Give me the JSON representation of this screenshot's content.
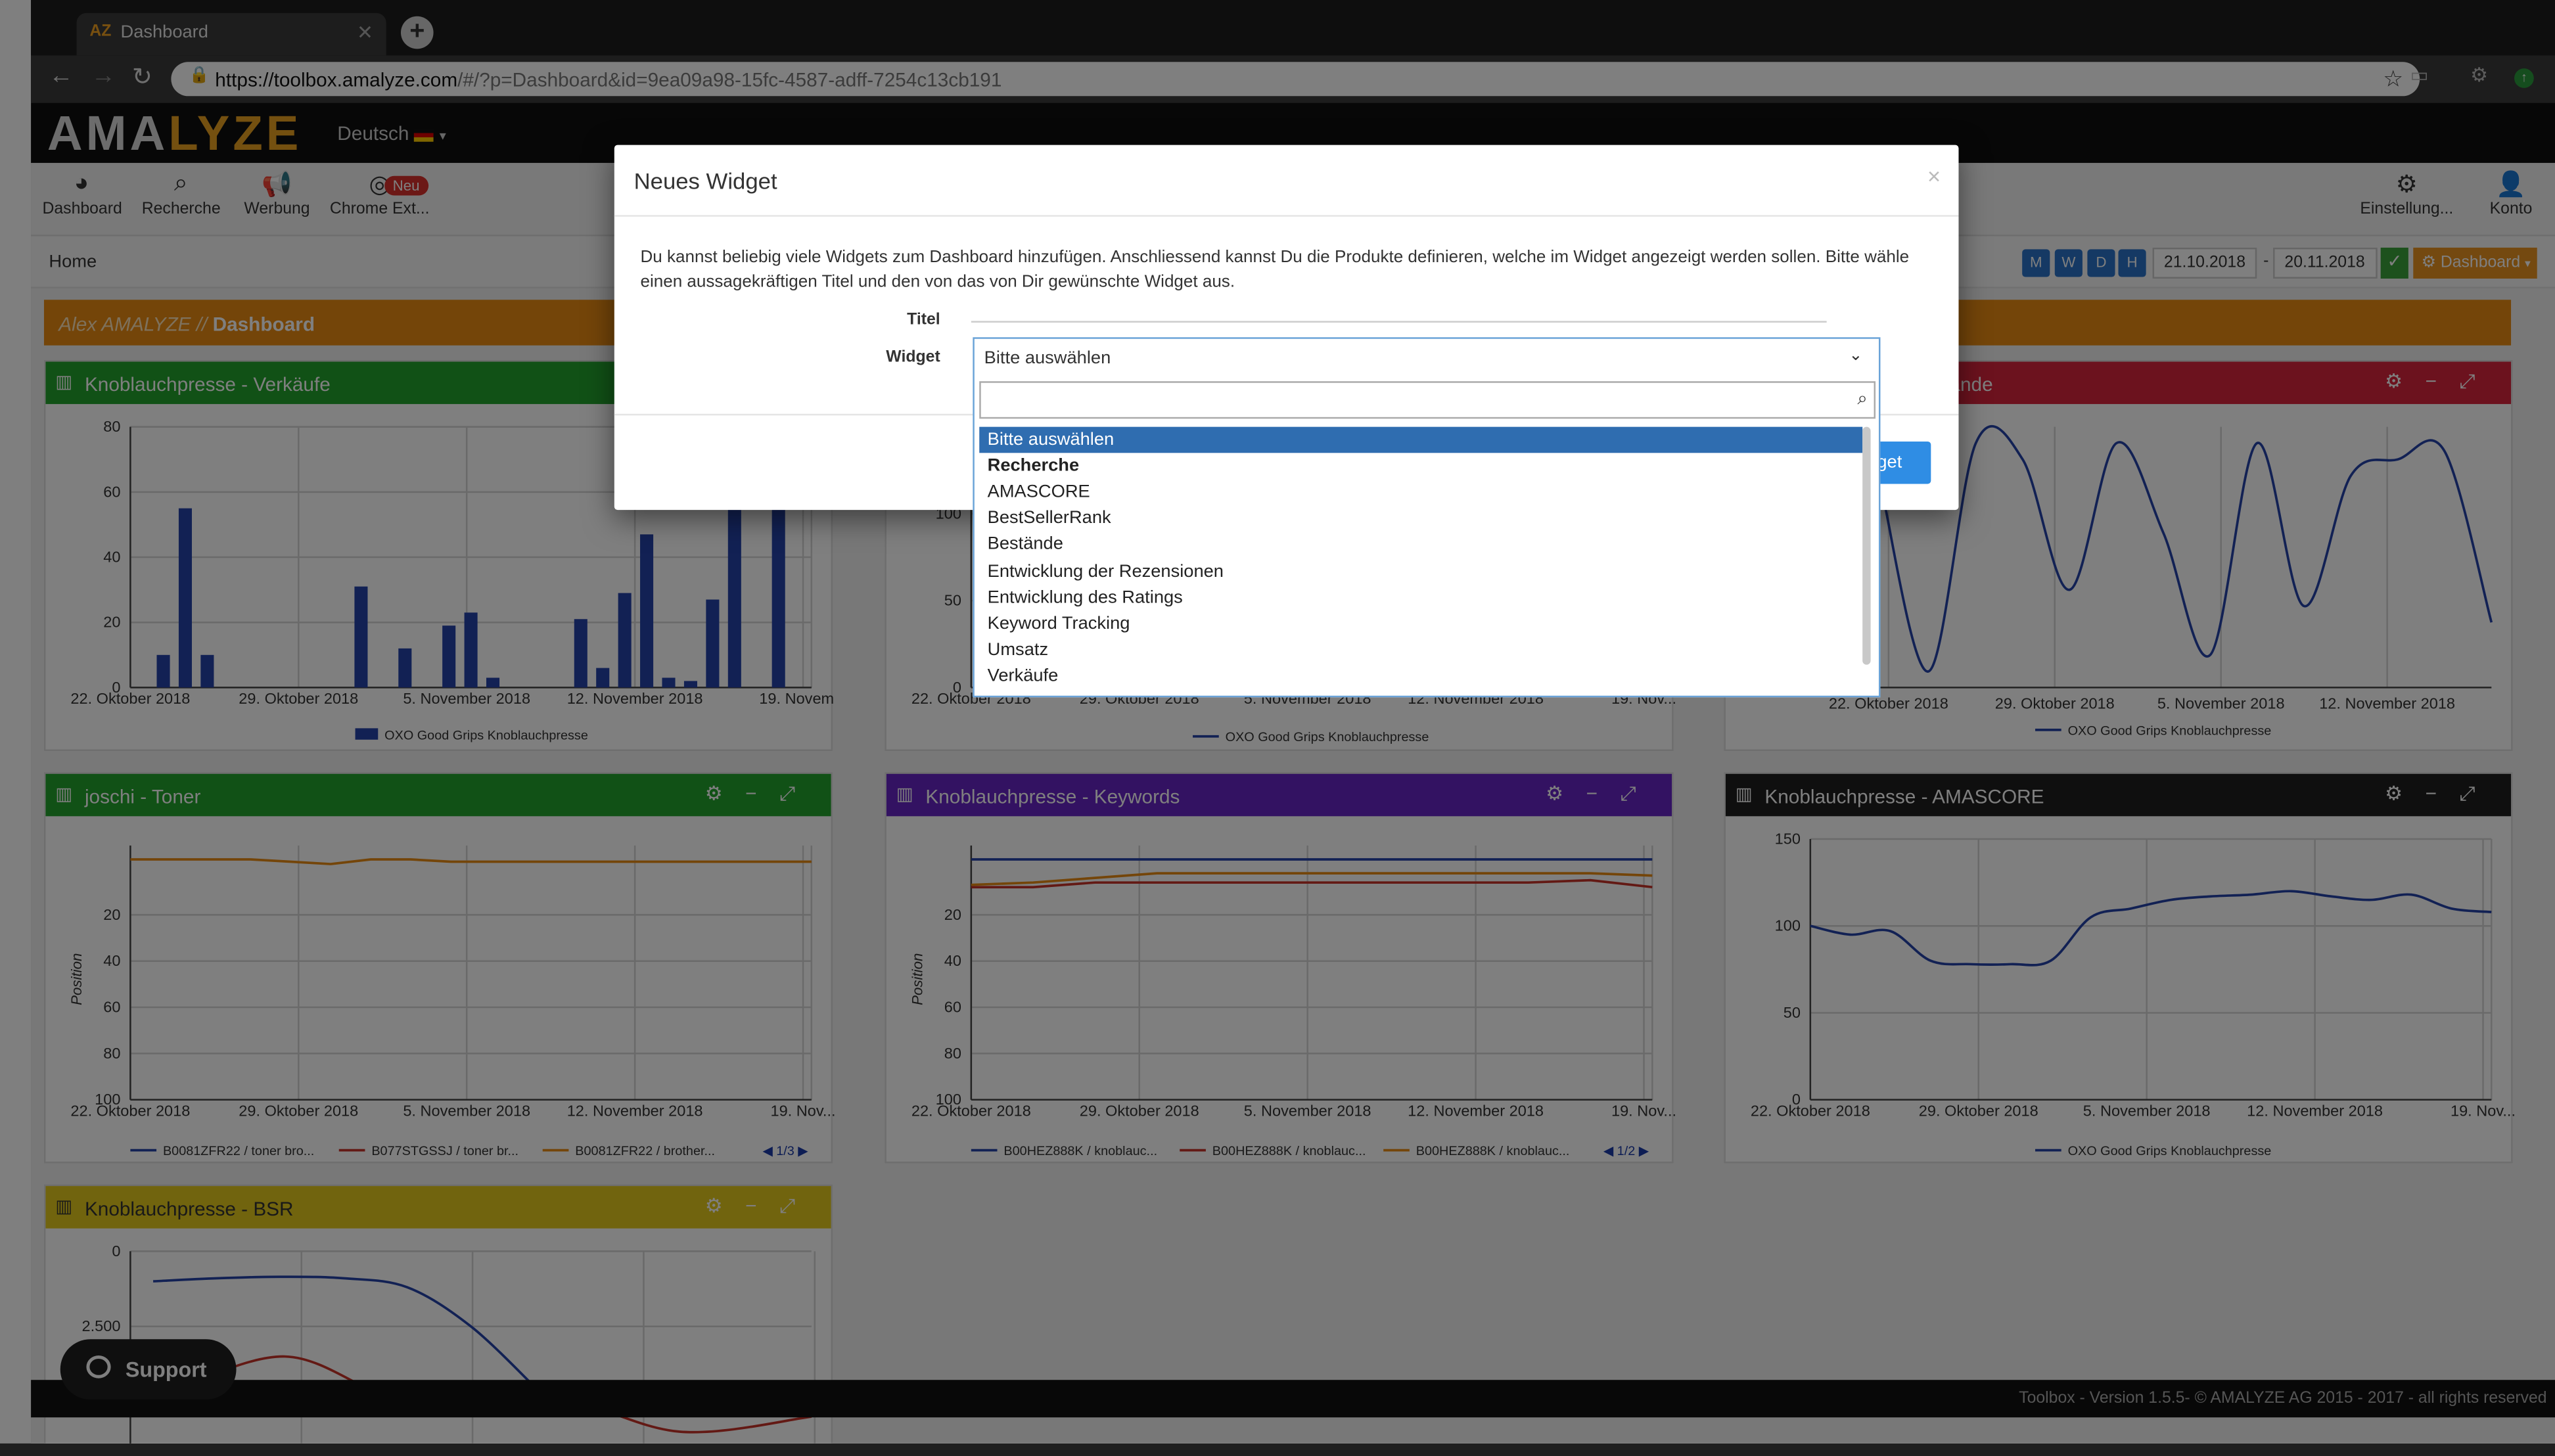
{
  "browser": {
    "tab_title": "Dashboard",
    "favicon_text": "AZ",
    "url_domain": "https://toolbox.amalyze.com",
    "url_path": "/#/?p=Dashboard&id=9ea09a98-15fc-4587-adff-7254c13cb191"
  },
  "app": {
    "logo_main": "AMA",
    "logo_accent": "LYZE",
    "language": "Deutsch",
    "menu": [
      {
        "label": "Dashboard",
        "icon": "dashboard-icon"
      },
      {
        "label": "Recherche",
        "icon": "search-icon"
      },
      {
        "label": "Werbung",
        "icon": "megaphone-icon"
      },
      {
        "label": "Chrome Ext...",
        "icon": "chrome-icon"
      }
    ],
    "badge_new": "Neu",
    "settings_label": "Einstellung...",
    "account_label": "Konto",
    "breadcrumb": "Home",
    "periods": [
      "M",
      "W",
      "D",
      "H"
    ],
    "date_from": "21.10.2018",
    "date_sep": "-",
    "date_to": "20.11.2018",
    "dashboard_button": "Dashboard",
    "page_user": "Alex AMALYZE //",
    "page_title": "Dashboard",
    "footer": "Toolbox - Version 1.5.5- © AMALYZE AG 2015 - 2017 - all rights reserved",
    "support_label": "Support",
    "colors": {
      "orange": "#e88a12",
      "green": "#22a22d",
      "red": "#d9243c",
      "purple": "#6624c4",
      "black": "#1f1f1f",
      "yellow": "#e3c81c",
      "series_blue": "#2442a8"
    }
  },
  "widgets": [
    {
      "title": "Knoblauchpresse - Verkäufe",
      "color": "#22a22d"
    },
    {
      "title": "",
      "color": "#ffffff"
    },
    {
      "title": "tände",
      "color": "#d9243c"
    },
    {
      "title": "joschi - Toner",
      "color": "#22a22d"
    },
    {
      "title": "Knoblauchpresse - Keywords",
      "color": "#6624c4"
    },
    {
      "title": "Knoblauchpresse - AMASCORE",
      "color": "#1f1f1f"
    },
    {
      "title": "Knoblauchpresse - BSR",
      "color": "#e3c81c"
    }
  ],
  "legends": {
    "product": "OXO Good Grips Knoblauchpresse",
    "toner": [
      "B0081ZFR22 / toner bro...",
      "B077STGSSJ / toner br...",
      "B0081ZFR22 / brother..."
    ],
    "toner_page": "1/3",
    "keywords": [
      "B00HEZ888K / knoblauc...",
      "B00HEZ888K / knoblauc...",
      "B00HEZ888K / knoblauc..."
    ],
    "keywords_page": "1/2",
    "y_position": "Position"
  },
  "chart_data": [
    {
      "type": "bar",
      "title": "Knoblauchpresse - Verkäufe",
      "x_ticks": [
        "22. Oktober 2018",
        "29. Oktober 2018",
        "5. November 2018",
        "12. November 2018",
        "19. Novem..."
      ],
      "ylim": [
        0,
        80
      ],
      "y_ticks": [
        0,
        20,
        40,
        60,
        80
      ],
      "series": [
        {
          "name": "OXO Good Grips Knoblauchpresse",
          "values": [
            10,
            55,
            10,
            0,
            0,
            0,
            0,
            0,
            0,
            31,
            0,
            12,
            0,
            19,
            23,
            3,
            0,
            0,
            0,
            21,
            6,
            29,
            47,
            3,
            2,
            27,
            80,
            0,
            80
          ]
        }
      ]
    },
    {
      "type": "line",
      "title": "",
      "x_ticks": [
        "22. Oktober 2018",
        "29. Oktober 2018",
        "5. November 2018",
        "12. November 2018",
        "19. Nov..."
      ],
      "ylim": [
        0,
        150
      ],
      "y_ticks": [
        0,
        50,
        100
      ],
      "series": [
        {
          "name": "OXO Good Grips Knoblauchpresse",
          "values": []
        }
      ]
    },
    {
      "type": "line",
      "title": "tände",
      "x_ticks": [
        "22. Oktober 2018",
        "29. Oktober 2018",
        "5. November 2018",
        "12. November 2018"
      ],
      "series": [
        {
          "name": "OXO Good Grips Knoblauchpresse",
          "values": [
            120,
            10,
            150,
            140,
            60,
            150,
            95,
            20,
            150,
            50,
            130,
            140,
            145,
            40
          ]
        }
      ]
    },
    {
      "type": "line",
      "title": "joschi - Toner",
      "x_ticks": [
        "22. Oktober 2018",
        "29. Oktober 2018",
        "5. November 2018",
        "12. November 2018",
        "19. Nov..."
      ],
      "ylabel": "Position",
      "ylim": [
        100,
        0
      ],
      "y_ticks": [
        20,
        40,
        60,
        80,
        100
      ],
      "series": [
        {
          "name": "B0081ZFR22 / brother...",
          "values": [
            -4,
            -4,
            -4,
            -4,
            -3,
            -2,
            -4,
            -4,
            -3,
            -3,
            -3,
            -3,
            -3,
            -3,
            -3,
            -3,
            -3,
            -3
          ]
        }
      ]
    },
    {
      "type": "line",
      "title": "Knoblauchpresse - Keywords",
      "x_ticks": [
        "22. Oktober 2018",
        "29. Oktober 2018",
        "5. November 2018",
        "12. November 2018",
        "19. Nov..."
      ],
      "ylabel": "Position",
      "ylim": [
        100,
        0
      ],
      "y_ticks": [
        20,
        40,
        60,
        80,
        100
      ],
      "series": [
        {
          "name": "B00HEZ888K / knoblauc...",
          "values": [
            -4,
            -4,
            -4,
            -4,
            -4,
            -4,
            -4,
            -4,
            -4,
            -4,
            -4,
            -4
          ]
        },
        {
          "name": "B00HEZ888K / knoblauc...",
          "values": [
            8,
            8,
            6,
            6,
            6,
            6,
            6,
            6,
            6,
            6,
            5,
            8
          ]
        },
        {
          "name": "B00HEZ888K / knoblauc...",
          "values": [
            7,
            6,
            4,
            2,
            2,
            2,
            2,
            2,
            2,
            2,
            2,
            3
          ]
        }
      ]
    },
    {
      "type": "line",
      "title": "Knoblauchpresse - AMASCORE",
      "x_ticks": [
        "22. Oktober 2018",
        "29. Oktober 2018",
        "5. November 2018",
        "12. November 2018",
        "19. Nov..."
      ],
      "ylim": [
        0,
        150
      ],
      "y_ticks": [
        0,
        50,
        100,
        150
      ],
      "series": [
        {
          "name": "OXO Good Grips Knoblauchpresse",
          "values": [
            100,
            95,
            97,
            80,
            78,
            78,
            80,
            105,
            110,
            115,
            117,
            118,
            120,
            117,
            115,
            118,
            110,
            108
          ]
        }
      ]
    },
    {
      "type": "line",
      "title": "Knoblauchpresse - BSR",
      "y_ticks": [
        "0",
        "2.500"
      ],
      "series": [
        {
          "name": "",
          "values": [
            1000,
            900,
            850,
            900,
            1200,
            2500,
            4500
          ]
        },
        {
          "name": "",
          "values": [
            5000,
            3500,
            5200,
            4800,
            6000,
            5500
          ]
        }
      ]
    }
  ],
  "modal": {
    "title": "Neues Widget",
    "close": "×",
    "description": "Du kannst beliebig viele Widgets zum Dashboard hinzufügen. Anschliessend kannst Du die Produkte definieren, welche im Widget angezeigt werden sollen. Bitte wähle einen aussagekräftigen Titel und den von das von Dir gewünschte Widget aus.",
    "label_title": "Titel",
    "label_widget": "Widget",
    "title_value": "",
    "selected": "Bitte auswählen",
    "add_button": "Widget",
    "options": [
      {
        "label": "Bitte auswählen",
        "kind": "selected"
      },
      {
        "label": "Recherche",
        "kind": "group"
      },
      {
        "label": "AMASCORE",
        "kind": "item"
      },
      {
        "label": "BestSellerRank",
        "kind": "item"
      },
      {
        "label": "Bestände",
        "kind": "item"
      },
      {
        "label": "Entwicklung der Rezensionen",
        "kind": "item"
      },
      {
        "label": "Entwicklung des Ratings",
        "kind": "item"
      },
      {
        "label": "Keyword Tracking",
        "kind": "item"
      },
      {
        "label": "Umsatz",
        "kind": "item"
      },
      {
        "label": "Verkäufe",
        "kind": "item"
      }
    ]
  }
}
